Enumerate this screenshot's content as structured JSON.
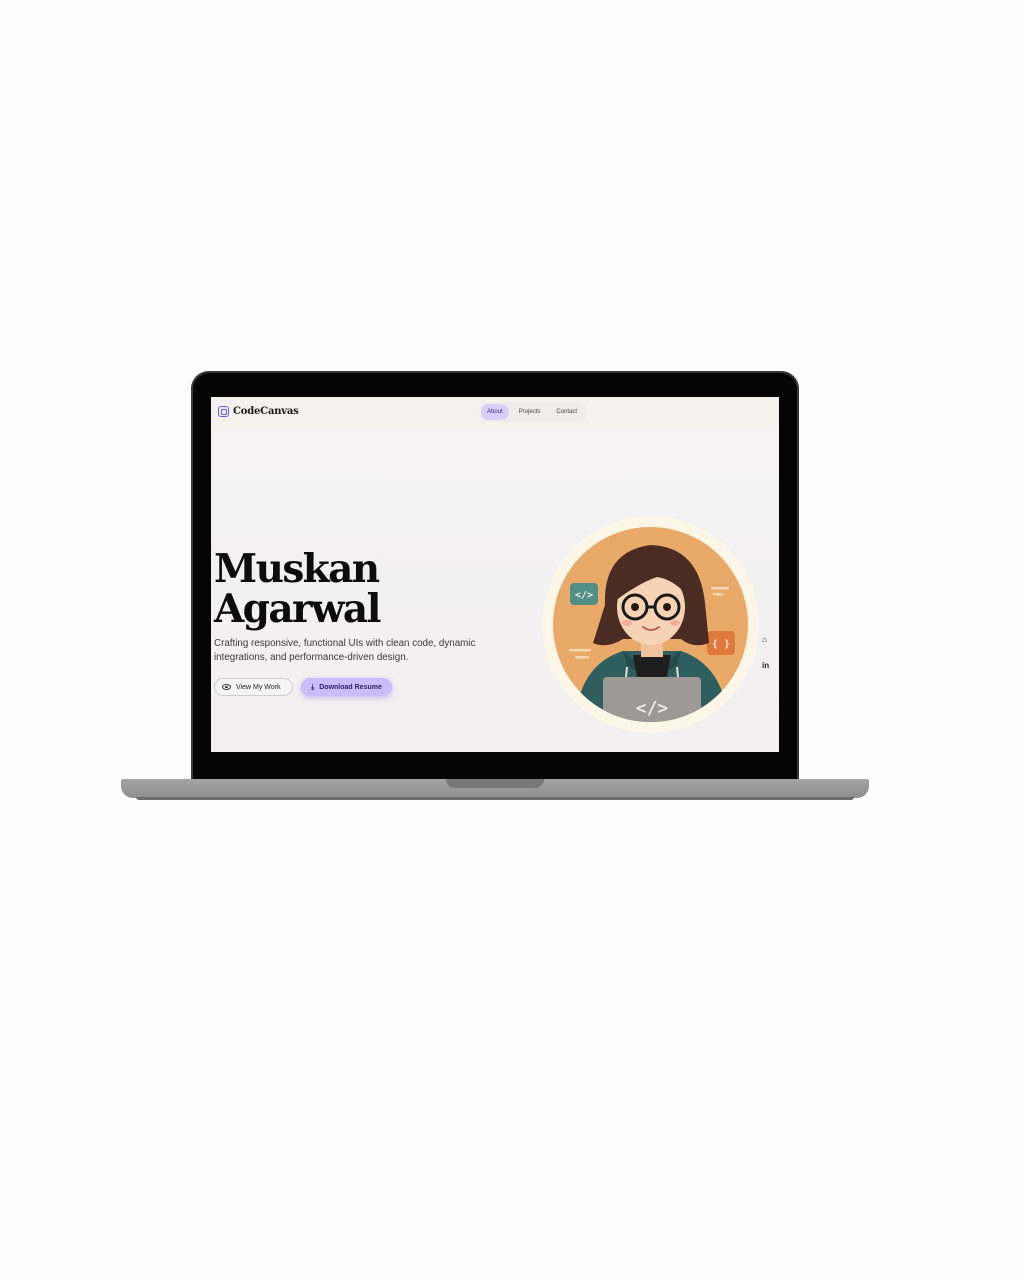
{
  "brand": {
    "name": "CodeCanvas",
    "logo_icon": "code-canvas-logo-icon",
    "accent": "#6f61d9"
  },
  "nav": {
    "links": [
      {
        "label": "About",
        "active": true
      },
      {
        "label": "Projects",
        "active": false
      },
      {
        "label": "Contact",
        "active": false
      }
    ],
    "active_color": "#d8cdfb"
  },
  "hero": {
    "name_line1": "Muskan",
    "name_line2": "Agarwal",
    "subtitle_line1": "Crafting responsive, functional UIs with clean code, dynamic",
    "subtitle_line2": "integrations, and performance-driven design.",
    "view_work_label": "View My Work",
    "view_work_icon": "eye-icon",
    "download_label": "Download Resume",
    "download_icon": "download-icon",
    "primary_color": "#cbbcfb"
  },
  "avatar": {
    "icon": "developer-avatar-illustration",
    "background": "#e9a968",
    "badges": [
      "</>",
      "{ }"
    ]
  },
  "social": [
    {
      "icon": "github-icon"
    },
    {
      "icon": "linkedin-icon"
    }
  ]
}
